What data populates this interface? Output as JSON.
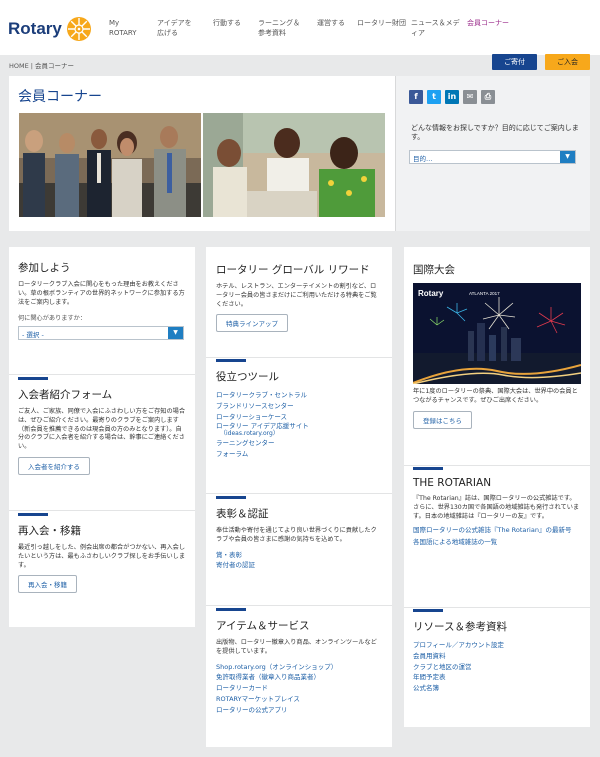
{
  "header": {
    "logo_text": "Rotary",
    "nav": [
      {
        "label": "My\nROTARY"
      },
      {
        "label": "アイデアを\n広げる"
      },
      {
        "label": "行動する"
      },
      {
        "label": "ラーニング＆\n参考資料"
      },
      {
        "label": "運営する"
      },
      {
        "label": "ロータリー財団"
      },
      {
        "label": "ニュース＆メデ\nィア"
      },
      {
        "label": "会員コーナー"
      }
    ]
  },
  "breadcrumb": "HOME | 会員コーナー",
  "actions": {
    "donate": "ご寄付",
    "join": "ご入会"
  },
  "hero": {
    "title": "会員コーナー"
  },
  "sidebar": {
    "question": "どんな情報をお探しですか？目的に応じてご案内します。",
    "select_value": "目的…"
  },
  "col1": {
    "s1": {
      "title": "参加しよう",
      "body": "ロータリークラブ入会に関心をもった理由をお教えください。草の根ボランティアの世界的ネットワークに参加する方法をご案内します。",
      "label": "何に関心がありますか：",
      "select": "- 選択 -"
    },
    "s2": {
      "title": "入会者紹介フォーム",
      "body": "ご友人、ご家族、同僚で入会にふさわしい方をご存知の場合は、ぜひご紹介ください。最寄りのクラブをご案内します（新会員を推薦できるのは現会員の方のみとなります）。自分のクラブに入会者を紹介する場合は、幹事にご連絡ください。",
      "button": "入会者を紹介する"
    },
    "s3": {
      "title": "再入会・移籍",
      "body": "最近引っ越しをした、例会出席の都合がつかない、再入会したいという方は、最もふさわしいクラブ探しをお手伝いします。",
      "button": "再入会・移籍"
    }
  },
  "col2": {
    "s1": {
      "title": "ロータリー グローバル リワード",
      "body": "ホテル、レストラン、エンターテイメントの割引など、ロータリー会員の皆さまだけにご利用いただける特典をご覧ください。",
      "button": "特典ラインアップ"
    },
    "s2": {
      "title": "役立つツール",
      "links": [
        "ロータリークラブ・セントラル",
        "ブランドリソースセンター",
        "ロータリーショーケース",
        "ロータリー アイデア応援サイト",
        "ラーニングセンター",
        "フォーラム"
      ],
      "sub": "（ideas.rotary.org）"
    },
    "s3": {
      "title": "表彰＆認証",
      "body": "奉仕活動や寄付を通じてより良い世界づくりに貢献したクラブや会員の皆さまに感謝の気持ちを込めて。",
      "links": [
        "賞・表彰",
        "寄付者の認証"
      ]
    },
    "s4": {
      "title": "アイテム＆サービス",
      "body": "出版物、ロータリー徽章入り商品、オンラインツールなどを提供しています。",
      "links": [
        "Shop.rotary.org（オンラインショップ）",
        "免許取得業者（徽章入り商品業者）",
        "ロータリーカード",
        "ROTARYマーケットプレイス",
        "ロータリーの公式アプリ"
      ]
    }
  },
  "col3": {
    "s1": {
      "title": "国際大会",
      "body": "年に1度のロータリーの祭典、国際大会は、世界中の会員とつながるチャンスです。ぜひご出席ください。",
      "button": "登録はこちら",
      "img_logo": "Rotary",
      "img_badge": "ATLANTA 2017"
    },
    "s2": {
      "title": "THE ROTARIAN",
      "body": "『The Rotarian』誌は、国際ロータリーの公式雑誌です。さらに、世界130カ国で各国語の地域雑誌も発行されています。日本の地域雑誌は『ロータリーの友』です。",
      "links": [
        "国際ロータリーの公式雑誌『The Rotarian』の最新号",
        "各国語による地域雑誌の一覧"
      ]
    },
    "s3": {
      "title": "リソース＆参考資料",
      "links": [
        "プロフィール／アカウント設定",
        "会員用資料",
        "クラブと地区の運営",
        "年間予定表",
        "公式名簿"
      ]
    }
  }
}
